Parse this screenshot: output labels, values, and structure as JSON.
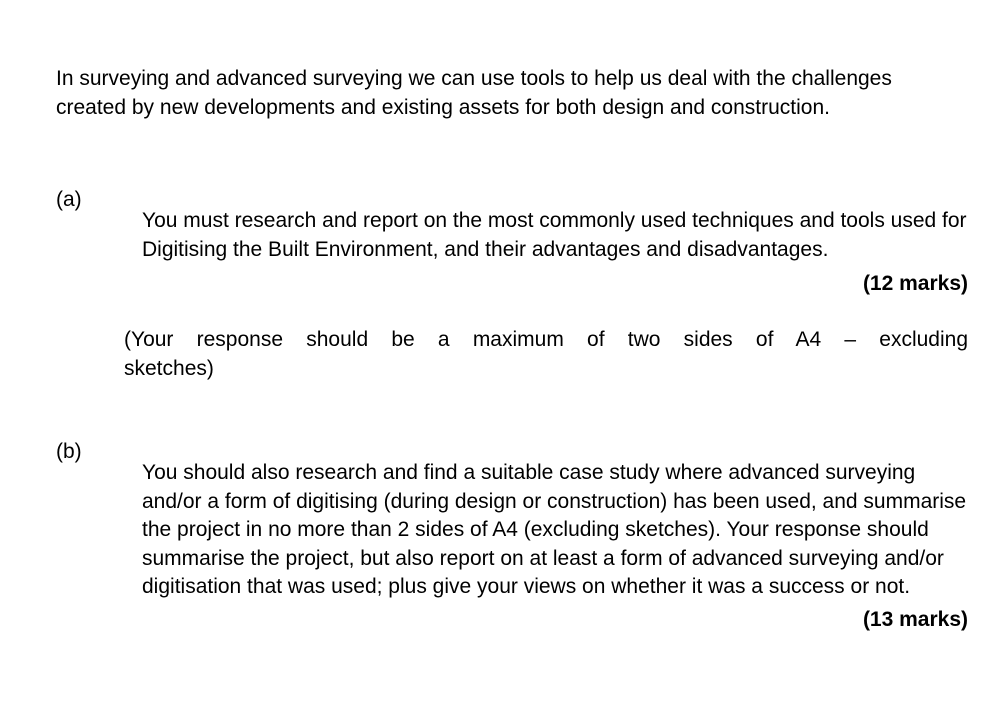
{
  "document": {
    "background_color": "#ffffff",
    "text_color": "#000000",
    "intro": "In surveying and advanced surveying we can use tools to help us deal with the challenges created by new developments and existing assets for both design and construction.",
    "questions": [
      {
        "label": "(a)",
        "text": "You must research and report on the most commonly used techniques and tools used for Digitising the Built Environment, and their advantages and disadvantages.",
        "marks": "(12 marks)",
        "note_line_1": "(Your response should be a maximum of two sides of A4 – excluding",
        "note_line_2": "sketches)"
      },
      {
        "label": "(b)",
        "text": "You should also research and find a suitable case study where advanced surveying and/or a form of digitising (during design or construction) has been used, and summarise the project in no more than 2 sides of A4 (excluding sketches). Your response should summarise the project, but also report on at least a form of advanced surveying and/or digitisation that was used; plus give your views on whether it was a success or not.",
        "marks": "(13 marks)"
      }
    ]
  }
}
